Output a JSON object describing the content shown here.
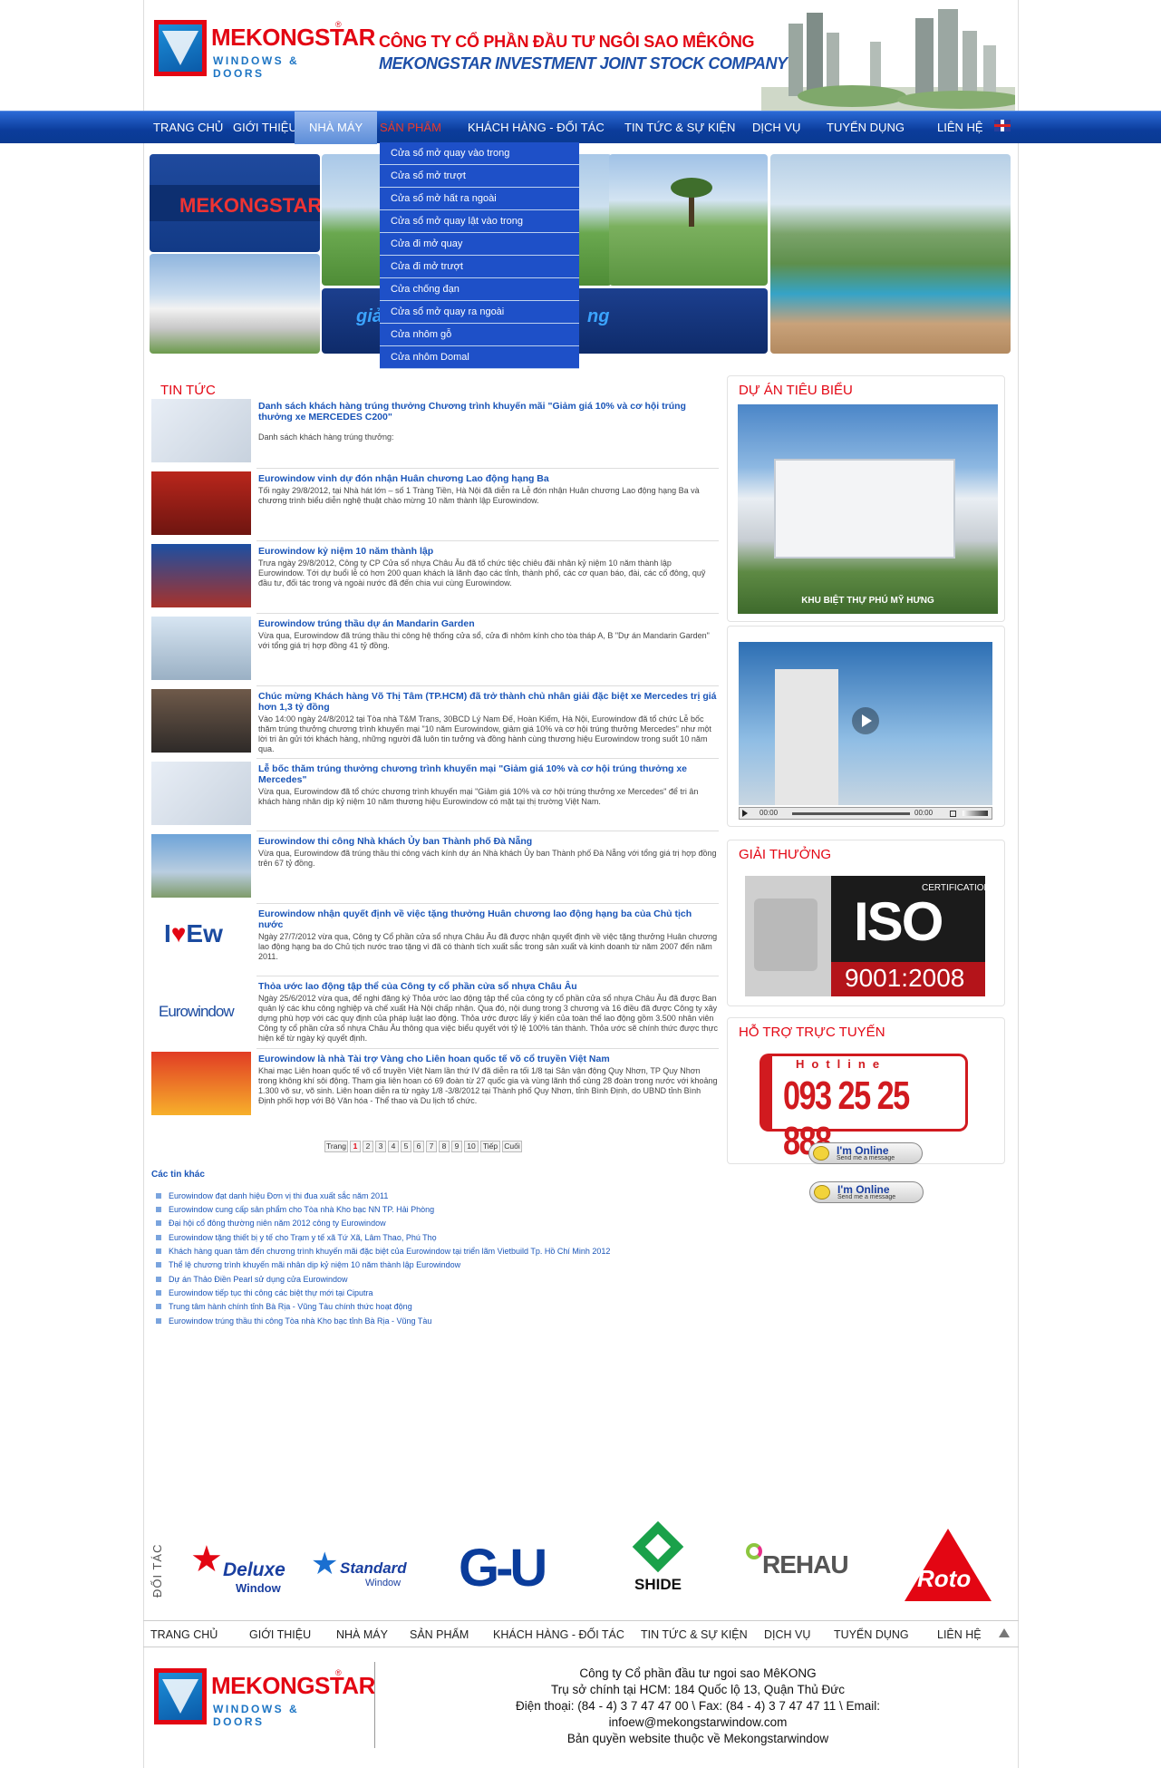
{
  "brand": {
    "name": "MEKONGSTAR",
    "sub": "WINDOWS & DOORS",
    "reg": "®"
  },
  "company": {
    "vn": "CÔNG TY CỔ PHẦN ĐẦU TƯ NGÔI SAO MÊKÔNG",
    "en": "MEKONGSTAR INVESTMENT JOINT STOCK COMPANY"
  },
  "nav": [
    "TRANG CHỦ",
    "GIỚI THIỆU",
    "NHÀ MÁY",
    "SẢN PHẨM",
    "KHÁCH HÀNG - ĐỐI TÁC",
    "TIN TỨC & SỰ KIỆN",
    "DỊCH VỤ",
    "TUYỂN DỤNG",
    "LIÊN HỆ"
  ],
  "dropdown": [
    "Cửa sổ mở quay vào trong",
    "Cửa sổ mở trượt",
    "Cửa sổ mở hất ra ngoài",
    "Cửa sổ mở quay lật vào trong",
    "Cửa đi mở quay",
    "Cửa đi mở trượt",
    "Cửa chống đạn",
    "Cửa sổ mở quay ra ngoài",
    "Cửa nhôm gỗ",
    "Cửa nhôm Domal"
  ],
  "banner": {
    "brand": "MEKONGSTAR",
    "slogan_left": "giả",
    "slogan_right": "ng"
  },
  "news": {
    "title": "TIN TỨC",
    "items": [
      {
        "title": "Danh sách khách hàng trúng thưởng Chương trình khuyến mãi \"Giảm giá 10% và cơ hội trúng thưởng xe MERCEDES C200\"",
        "desc": "Danh sách khách hàng trúng thưởng:"
      },
      {
        "title": "Eurowindow vinh dự đón nhận Huân chương Lao động hạng Ba",
        "desc": "Tối ngày 29/8/2012, tại Nhà hát lớn – số 1 Tràng Tiền, Hà Nội đã diễn ra Lễ đón nhận Huân chương Lao động hạng Ba và chương trình biểu diễn nghệ thuật chào mừng 10 năm thành lập Eurowindow."
      },
      {
        "title": "Eurowindow kỷ niệm 10 năm thành lập",
        "desc": "Trưa ngày 29/8/2012, Công ty CP Cửa sổ nhựa Châu Âu đã tổ chức tiệc chiêu đãi nhân kỷ niệm 10 năm thành lập Eurowindow. Tới dự buổi lễ có hơn 200 quan khách là lãnh đạo các tỉnh, thành phố, các cơ quan báo, đài, các cổ đông, quỹ đầu tư, đối tác trong và ngoài nước đã đến chia vui cùng Eurowindow."
      },
      {
        "title": "Eurowindow trúng thầu dự án Mandarin Garden",
        "desc": "Vừa qua, Eurowindow đã trúng thầu thi công hệ thống cửa sổ, cửa đi nhôm kính cho tòa tháp A, B \"Dự án Mandarin Garden\" với tổng giá trị hợp đồng 41 tỷ đồng."
      },
      {
        "title": "Chúc mừng Khách hàng Võ Thị Tâm (TP.HCM) đã trở thành chủ nhân giải đặc biệt xe Mercedes trị giá hơn 1,3 tỷ đồng",
        "desc": "Vào 14:00 ngày 24/8/2012 tại Tòa nhà T&M Trans, 30BCD Lý Nam Đế, Hoàn Kiếm, Hà Nội, Eurowindow đã tổ chức Lễ bốc thăm trúng thưởng chương trình khuyến mại \"10 năm Eurowindow, giảm giá 10% và cơ hội trúng thưởng Mercedes\" như một lời tri ân gửi tới khách hàng, những người đã luôn tin tưởng và đồng hành cùng thương hiệu Eurowindow trong suốt 10 năm qua."
      },
      {
        "title": "Lễ bốc thăm trúng thưởng chương trình khuyến mại \"Giảm giá 10% và cơ hội trúng thưởng xe Mercedes\"",
        "desc": "Vừa qua, Eurowindow đã tổ chức chương trình khuyến mại \"Giảm giá 10% và cơ hội trúng thưởng xe Mercedes\" để tri ân khách hàng nhân dịp kỷ niệm 10 năm thương hiệu Eurowindow có mặt tại thị trường Việt Nam."
      },
      {
        "title": "Eurowindow thi công Nhà khách Ủy ban Thành phố Đà Nẵng",
        "desc": "Vừa qua, Eurowindow đã trúng thầu thi công vách kính dự án Nhà khách Ủy ban Thành phố Đà Nẵng với tổng giá trị hợp đồng trên 67 tỷ đồng."
      },
      {
        "title": "Eurowindow nhận quyết định về việc tặng thưởng Huân chương lao động hạng ba của Chủ tịch nước",
        "desc": "Ngày 27/7/2012 vừa qua, Công ty Cổ phần cửa sổ nhựa Châu Âu đã được nhận quyết định về việc tặng thưởng Huân chương lao động hạng ba do Chủ tịch nước trao tặng vì đã có thành tích xuất sắc trong sản xuất và kinh doanh từ năm 2007 đến năm 2011."
      },
      {
        "title": "Thỏa ước lao động tập thể của Công ty cổ phần cửa sổ nhựa Châu Âu",
        "desc": "Ngày 25/6/2012 vừa qua, để nghi đăng ký Thỏa ước lao động tập thể của công ty cổ phần cửa sổ nhựa Châu Âu đã được Ban quản lý các khu công nghiệp và chế xuất Hà Nội chấp nhận. Qua đó, nội dung trong 3 chương và 16 điều đã được Công ty xây dựng phù hợp với các quy định của pháp luật lao động. Thỏa ước được lấy ý kiến của toàn thể lao động gồm 3.500 nhân viên Công ty cổ phần cửa sổ nhựa Châu Âu thông qua việc biểu quyết với tỷ lệ 100% tán thành. Thỏa ước sẽ chính thức được thực hiện kể từ ngày ký quyết định."
      },
      {
        "title": "Eurowindow là nhà Tài trợ Vàng cho Liên hoan quốc tế võ cổ truyền Việt Nam",
        "desc": "Khai mạc Liên hoan quốc tế võ cổ truyền Việt Nam lần thứ IV đã diễn ra tối 1/8 tại Sân vận động Quy Nhơn, TP Quy Nhơn trong không khí sôi động. Tham gia liên hoan có 69 đoàn từ 27 quốc gia và vùng lãnh thổ cùng 28 đoàn trong nước với khoảng 1.300 võ sư, võ sinh. Liên hoan diễn ra từ ngày 1/8 -3/8/2012 tại Thành phố Quy Nhơn, tỉnh Bình Định, do UBND tỉnh Bình Định phối hợp với Bộ Văn hóa - Thể thao và Du lịch tổ chức."
      }
    ]
  },
  "pager": {
    "label": "Trang",
    "pages": [
      "1",
      "2",
      "3",
      "4",
      "5",
      "6",
      "7",
      "8",
      "9",
      "10"
    ],
    "next": "Tiếp",
    "last": "Cuối",
    "current": "1"
  },
  "other_news": {
    "title": "Các tin khác",
    "items": [
      "Eurowindow đạt danh hiệu Đơn vị thi đua xuất sắc năm 2011",
      "Eurowindow cung cấp sản phẩm cho Tòa nhà Kho bạc NN TP. Hải Phòng",
      "Đại hội cổ đông thường niên năm 2012 công ty Eurowindow",
      "Eurowindow tặng thiết bị y tế cho Trạm y tế xã Tứ Xã, Lâm Thao, Phú Thọ",
      "Khách hàng quan tâm đến chương trình khuyến mãi đặc biệt của Eurowindow tại triển lãm Vietbuild Tp. Hồ Chí Minh 2012",
      "Thể lệ chương trình khuyến mãi nhân dịp kỷ niệm 10 năm thành lập Eurowindow",
      "Dự án Thảo Điền Pearl sử dụng cửa Eurowindow",
      "Eurowindow tiếp tục thi công các biệt thự mới tại Ciputra",
      "Trung tâm hành chính tỉnh Bà Rịa - Vũng Tàu chính thức hoạt động",
      "Eurowindow trúng thầu thi công Tòa nhà Kho bạc tỉnh Bà Rịa - Vũng Tàu"
    ]
  },
  "sidebar": {
    "projects_title": "DỰ ÁN TIÊU BIỂU",
    "project_caption": "KHU BIỆT THỰ PHÚ MỸ HƯNG",
    "video": {
      "time_left": "00:00",
      "time_right": "00:00"
    },
    "awards_title": "GIẢI THƯỞNG",
    "iso": {
      "cert": "CERTIFICATION",
      "big": "ISO",
      "num": "9001:2008"
    },
    "support_title": "HỖ TRỢ TRỰC TUYẾN",
    "hotline_label": "Hotline",
    "hotline": "093 25 25 888",
    "online_1": {
      "main": "I'm Online",
      "sub": "Send me a message"
    },
    "online_2": {
      "main": "I'm Online",
      "sub": "Send me a message"
    }
  },
  "partners": {
    "label": "ĐỐI TÁC",
    "items": [
      {
        "name": "Deluxe",
        "sub": "Window"
      },
      {
        "name": "Standard",
        "sub": "Window"
      },
      {
        "name": "G-U",
        "sub": ""
      },
      {
        "name": "SHIDE",
        "sub": ""
      },
      {
        "name": "REHAU",
        "sub": ""
      },
      {
        "name": "Roto",
        "sub": ""
      }
    ]
  },
  "footer": {
    "nav": [
      "TRANG CHỦ",
      "GIỚI THIỆU",
      "NHÀ MÁY",
      "SẢN PHẨM",
      "KHÁCH HÀNG - ĐỐI TÁC",
      "TIN TỨC & SỰ KIỆN",
      "DỊCH VỤ",
      "TUYỂN DỤNG",
      "LIÊN HỆ"
    ],
    "line1": "Công ty Cổ phần đầu tư ngoi sao MêKONG",
    "line2": "Trụ sở chính tại HCM: 184 Quốc lộ 13, Quận Thủ Đức",
    "line3": "Điện thoại: (84 - 4) 3 7 47 47 00 \\ Fax:  (84 - 4) 3 7 47 47 11 \\ Email: infoew@mekongstarwindow.com",
    "line4": "Bản quyền website thuộc về Mekongstarwindow"
  },
  "colors": {
    "brand_red": "#e30613",
    "nav_blue": "#0b3c9b",
    "link_blue": "#1a55b8"
  }
}
